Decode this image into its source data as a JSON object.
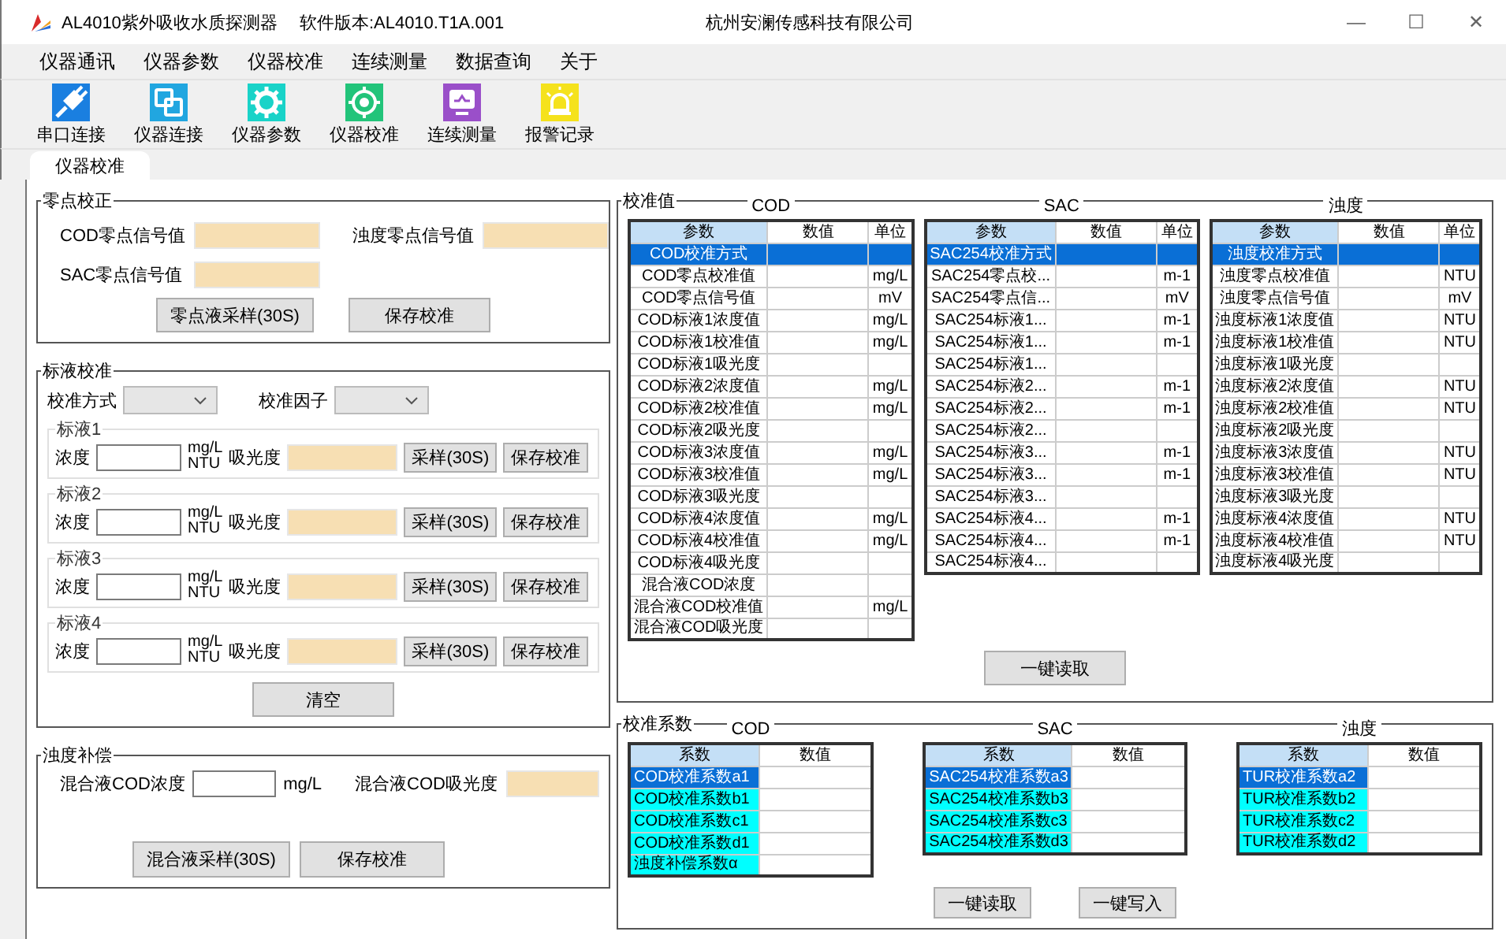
{
  "window": {
    "title": "AL4010紫外吸收水质探测器",
    "version": "软件版本:AL4010.T1A.001",
    "company": "杭州安澜传感科技有限公司",
    "controls": [
      "—",
      "☐",
      "✕"
    ]
  },
  "menu": [
    "仪器通讯",
    "仪器参数",
    "仪器校准",
    "连续测量",
    "数据查询",
    "关于"
  ],
  "toolbar": [
    {
      "label": "串口连接",
      "kind": "plug",
      "color": "#1a7fe0"
    },
    {
      "label": "仪器连接",
      "kind": "link",
      "color": "#21a6e0"
    },
    {
      "label": "仪器参数",
      "kind": "gear",
      "color": "#19d3c8"
    },
    {
      "label": "仪器校准",
      "kind": "target",
      "color": "#22c47a"
    },
    {
      "label": "连续测量",
      "kind": "monitor",
      "color": "#9a4fc9"
    },
    {
      "label": "报警记录",
      "kind": "alarm",
      "color": "#f5e21c"
    }
  ],
  "tabs": [
    {
      "label": "仪器校准",
      "selected": true
    }
  ],
  "zero": {
    "title": "零点校正",
    "fields": [
      "COD零点信号值",
      "浊度零点信号值",
      "SAC零点信号值"
    ],
    "buttons": [
      "零点液采样(30S)",
      "保存校准"
    ]
  },
  "standard": {
    "title": "标液校准",
    "selectors": [
      "校准方式",
      "校准因子"
    ],
    "items": [
      {
        "title": "标液1",
        "conc_label": "浓度",
        "units": [
          "mg/L",
          "NTU"
        ],
        "abs_label": "吸光度",
        "buttons": [
          "采样(30S)",
          "保存校准"
        ]
      },
      {
        "title": "标液2",
        "conc_label": "浓度",
        "units": [
          "mg/L",
          "NTU"
        ],
        "abs_label": "吸光度",
        "buttons": [
          "采样(30S)",
          "保存校准"
        ]
      },
      {
        "title": "标液3",
        "conc_label": "浓度",
        "units": [
          "mg/L",
          "NTU"
        ],
        "abs_label": "吸光度",
        "buttons": [
          "采样(30S)",
          "保存校准"
        ]
      },
      {
        "title": "标液4",
        "conc_label": "浓度",
        "units": [
          "mg/L",
          "NTU"
        ],
        "abs_label": "吸光度",
        "buttons": [
          "采样(30S)",
          "保存校准"
        ]
      }
    ],
    "clear": "清空"
  },
  "compensation": {
    "title": "浊度补偿",
    "conc_label": "混合液COD浓度",
    "unit": "mg/L",
    "abs_label": "混合液COD吸光度",
    "buttons": [
      "混合液采样(30S)",
      "保存校准"
    ]
  },
  "values": {
    "title": "校准值",
    "button": "一键读取",
    "tables": [
      {
        "caption": "COD",
        "columns": [
          "参数",
          "数值",
          "单位"
        ],
        "rows": [
          {
            "param": "COD校准方式",
            "selected": true
          },
          {
            "param": "COD零点校准值",
            "unit": "mg/L",
            "selected": false
          },
          {
            "param": "COD零点信号值",
            "unit": "mV",
            "selected": false
          },
          {
            "param": "COD标液1浓度值",
            "unit": "mg/L",
            "selected": false
          },
          {
            "param": "COD标液1校准值",
            "unit": "mg/L",
            "selected": false
          },
          {
            "param": "COD标液1吸光度",
            "selected": false
          },
          {
            "param": "COD标液2浓度值",
            "unit": "mg/L",
            "selected": false
          },
          {
            "param": "COD标液2校准值",
            "unit": "mg/L",
            "selected": false
          },
          {
            "param": "COD标液2吸光度",
            "selected": false
          },
          {
            "param": "COD标液3浓度值",
            "unit": "mg/L",
            "selected": false
          },
          {
            "param": "COD标液3校准值",
            "unit": "mg/L",
            "selected": false
          },
          {
            "param": "COD标液3吸光度",
            "selected": false
          },
          {
            "param": "COD标液4浓度值",
            "unit": "mg/L",
            "selected": false
          },
          {
            "param": "COD标液4校准值",
            "unit": "mg/L",
            "selected": false
          },
          {
            "param": "COD标液4吸光度",
            "selected": false
          },
          {
            "param": "混合液COD浓度",
            "selected": false
          },
          {
            "param": "混合液COD校准值",
            "unit": "mg/L",
            "selected": false
          },
          {
            "param": "混合液COD吸光度",
            "selected": false
          }
        ]
      },
      {
        "caption": "SAC",
        "columns": [
          "参数",
          "数值",
          "单位"
        ],
        "rows": [
          {
            "param": "SAC254校准方式",
            "selected": true
          },
          {
            "param": "SAC254零点校...",
            "unit": "m-1",
            "selected": false
          },
          {
            "param": "SAC254零点信...",
            "unit": "mV",
            "selected": false
          },
          {
            "param": "SAC254标液1...",
            "unit": "m-1",
            "selected": false
          },
          {
            "param": "SAC254标液1...",
            "unit": "m-1",
            "selected": false
          },
          {
            "param": "SAC254标液1...",
            "selected": false
          },
          {
            "param": "SAC254标液2...",
            "unit": "m-1",
            "selected": false
          },
          {
            "param": "SAC254标液2...",
            "unit": "m-1",
            "selected": false
          },
          {
            "param": "SAC254标液2...",
            "selected": false
          },
          {
            "param": "SAC254标液3...",
            "unit": "m-1",
            "selected": false
          },
          {
            "param": "SAC254标液3...",
            "unit": "m-1",
            "selected": false
          },
          {
            "param": "SAC254标液3...",
            "selected": false
          },
          {
            "param": "SAC254标液4...",
            "unit": "m-1",
            "selected": false
          },
          {
            "param": "SAC254标液4...",
            "unit": "m-1",
            "selected": false
          },
          {
            "param": "SAC254标液4...",
            "selected": false
          }
        ]
      },
      {
        "caption": "浊度",
        "columns": [
          "参数",
          "数值",
          "单位"
        ],
        "rows": [
          {
            "param": "浊度校准方式",
            "selected": true
          },
          {
            "param": "浊度零点校准值",
            "unit": "NTU",
            "selected": false
          },
          {
            "param": "浊度零点信号值",
            "unit": "mV",
            "selected": false
          },
          {
            "param": "浊度标液1浓度值",
            "unit": "NTU",
            "selected": false
          },
          {
            "param": "浊度标液1校准值",
            "unit": "NTU",
            "selected": false
          },
          {
            "param": "浊度标液1吸光度",
            "selected": false
          },
          {
            "param": "浊度标液2浓度值",
            "unit": "NTU",
            "selected": false
          },
          {
            "param": "浊度标液2校准值",
            "unit": "NTU",
            "selected": false
          },
          {
            "param": "浊度标液2吸光度",
            "selected": false
          },
          {
            "param": "浊度标液3浓度值",
            "unit": "NTU",
            "selected": false
          },
          {
            "param": "浊度标液3校准值",
            "unit": "NTU",
            "selected": false
          },
          {
            "param": "浊度标液3吸光度",
            "selected": false
          },
          {
            "param": "浊度标液4浓度值",
            "unit": "NTU",
            "selected": false
          },
          {
            "param": "浊度标液4校准值",
            "unit": "NTU",
            "selected": false
          },
          {
            "param": "浊度标液4吸光度",
            "selected": false
          }
        ]
      }
    ]
  },
  "coefficients": {
    "title": "校准系数",
    "buttons": [
      "一键读取",
      "一键写入"
    ],
    "tables": [
      {
        "caption": "COD",
        "columns": [
          "系数",
          "数值"
        ],
        "rows": [
          {
            "param": "COD校准系数a1",
            "selected": true
          },
          {
            "param": "COD校准系数b1",
            "selected": false
          },
          {
            "param": "COD校准系数c1",
            "selected": false
          },
          {
            "param": "COD校准系数d1",
            "selected": false
          },
          {
            "param": "浊度补偿系数α",
            "selected": false
          }
        ]
      },
      {
        "caption": "SAC",
        "columns": [
          "系数",
          "数值"
        ],
        "rows": [
          {
            "param": "SAC254校准系数a3",
            "selected": true
          },
          {
            "param": "SAC254校准系数b3",
            "selected": false
          },
          {
            "param": "SAC254校准系数c3",
            "selected": false
          },
          {
            "param": "SAC254校准系数d3",
            "selected": false
          }
        ]
      },
      {
        "caption": "浊度",
        "columns": [
          "系数",
          "数值"
        ],
        "rows": [
          {
            "param": "TUR校准系数a2",
            "selected": true
          },
          {
            "param": "TUR校准系数b2",
            "selected": false
          },
          {
            "param": "TUR校准系数c2",
            "selected": false
          },
          {
            "param": "TUR校准系数d2",
            "selected": false
          }
        ]
      }
    ]
  }
}
